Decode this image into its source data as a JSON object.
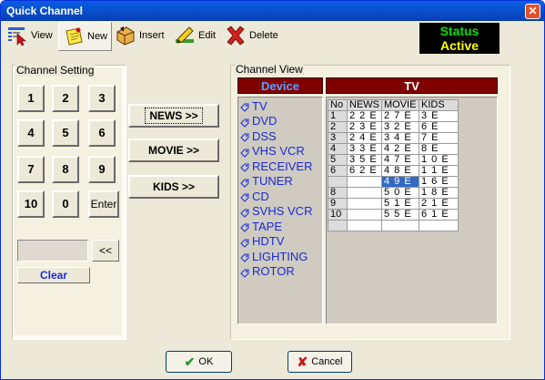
{
  "window": {
    "title": "Quick Channel",
    "close_glyph": "✕"
  },
  "toolbar": {
    "view_label": "View",
    "new_label": "New",
    "insert_label": "Insert",
    "edit_label": "Edit",
    "delete_label": "Delete"
  },
  "status": {
    "line1": "Status",
    "line2": "Active"
  },
  "channel_setting": {
    "label": "Channel Setting",
    "keys": [
      "1",
      "2",
      "3",
      "4",
      "5",
      "6",
      "7",
      "8",
      "9",
      "10",
      "0",
      "Enter"
    ],
    "display_value": "",
    "backspace_label": "<<",
    "clear_label": "Clear"
  },
  "categories": {
    "news_label": "NEWS >>",
    "movie_label": "MOVIE >>",
    "kids_label": "KIDS >>"
  },
  "channel_view": {
    "label": "Channel View",
    "device_header": "Device",
    "tv_header": "TV",
    "devices": [
      "TV",
      "DVD",
      "DSS",
      "VHS VCR",
      "RECEIVER",
      "TUNER",
      "CD",
      "SVHS VCR",
      "TAPE",
      "HDTV",
      "LIGHTING",
      "ROTOR"
    ],
    "columns": [
      "No",
      "NEWS",
      "MOVIE",
      "KIDS"
    ],
    "rows": [
      [
        "1",
        "2 2 E",
        "2 7 E",
        "3 E"
      ],
      [
        "2",
        "2 3 E",
        "3 2 E",
        "6 E"
      ],
      [
        "3",
        "2 4 E",
        "3 4 E",
        "7 E"
      ],
      [
        "4",
        "3 3 E",
        "4 2 E",
        "8 E"
      ],
      [
        "5",
        "3 5 E",
        "4 7 E",
        "1 0 E"
      ],
      [
        "6",
        "6 2 E",
        "4 8 E",
        "1 1 E"
      ],
      [
        "",
        "",
        "4 9 E",
        "1 6 E"
      ],
      [
        "8",
        "",
        "5 0 E",
        "1 8 E"
      ],
      [
        "9",
        "",
        "5 1 E",
        "2 1 E"
      ],
      [
        "10",
        "",
        "5 5 E",
        "6 1 E"
      ],
      [
        "",
        "",
        "",
        ""
      ]
    ],
    "selected_cell": "4 9 E"
  },
  "footer": {
    "ok_label": "OK",
    "cancel_label": "Cancel"
  },
  "colors": {
    "header_bg": "#800000",
    "device_header_text": "#5fa0ff",
    "tv_header_text": "#ffffff",
    "device_text": "#1a2bd8",
    "status_text": "#00e000",
    "status_active": "#ffff00"
  }
}
